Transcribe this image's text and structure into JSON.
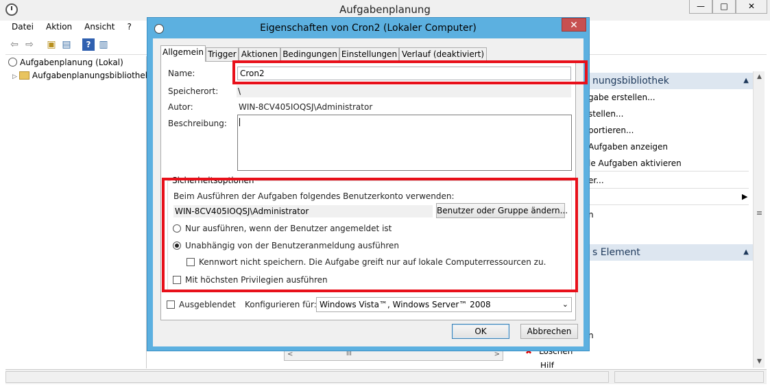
{
  "main_window": {
    "title": "Aufgabenplanung",
    "controls": {
      "minimize": "—",
      "maximize": "□",
      "close": "✕"
    },
    "menu": [
      "Datei",
      "Aktion",
      "Ansicht",
      "?"
    ],
    "toolbar_icons": [
      "back-arrow-icon",
      "forward-arrow-icon",
      "folder-up-icon",
      "show-hide-console-tree-icon",
      "help-icon",
      "show-hide-action-pane-icon"
    ],
    "tree": [
      {
        "label": "Aufgabenplanung (Lokal)",
        "expander": ""
      },
      {
        "label": "Aufgabenplanungsbibliothek",
        "expander": "▷"
      }
    ],
    "actions_pane": {
      "header1": "nungsbibliothek",
      "items1": [
        "gabe erstellen...",
        "stellen...",
        "portieren...",
        "Aufgaben anzeigen",
        "le Aufgaben aktivieren",
        "er...",
        "",
        "n"
      ],
      "header2": "s Element",
      "items2": [
        "n",
        "Löschen",
        "Hilf"
      ],
      "submenu_arrow": "▶",
      "collapse_arrow": "▲"
    },
    "scroll": {
      "up": "▲",
      "down": "▼",
      "grip": "≡",
      "hleft": "<",
      "hright": ">",
      "hgrip": "III"
    }
  },
  "dialog": {
    "title": "Eigenschaften von Cron2 (Lokaler Computer)",
    "close": "✕",
    "tabs": [
      "Allgemein",
      "Trigger",
      "Aktionen",
      "Bedingungen",
      "Einstellungen",
      "Verlauf (deaktiviert)"
    ],
    "active_tab": "Allgemein",
    "general": {
      "name_label": "Name:",
      "name_value": "Cron2",
      "location_label": "Speicherort:",
      "location_value": "\\",
      "author_label": "Autor:",
      "author_value": "WIN-8CV405IOQSJ\\Administrator",
      "description_label": "Beschreibung:",
      "description_value": ""
    },
    "security": {
      "group_label": "Sicherheitsoptionen",
      "account_prompt": "Beim Ausführen der Aufgaben folgendes Benutzerkonto verwenden:",
      "account_value": "WIN-8CV405IOQSJ\\Administrator",
      "change_button": "Benutzer oder Gruppe ändern...",
      "radio_logged_on": "Nur ausführen, wenn der Benutzer angemeldet ist",
      "radio_logged_on_selected": false,
      "radio_independent": "Unabhängig von der Benutzeranmeldung ausführen",
      "radio_independent_selected": true,
      "no_store_password": "Kennwort nicht speichern. Die Aufgabe greift nur auf lokale Computerressourcen zu.",
      "no_store_password_checked": false,
      "highest_privileges": "Mit höchsten Privilegien ausführen",
      "highest_privileges_checked": false
    },
    "hidden_label": "Ausgeblendet",
    "hidden_checked": false,
    "configure_label": "Konfigurieren für:",
    "configure_value": "Windows Vista™, Windows Server™ 2008",
    "ok_button": "OK",
    "cancel_button": "Abbrechen"
  },
  "colors": {
    "dialog_frame": "#5cb0e0",
    "highlight_box": "#e8101a",
    "close_button": "#c75050"
  }
}
